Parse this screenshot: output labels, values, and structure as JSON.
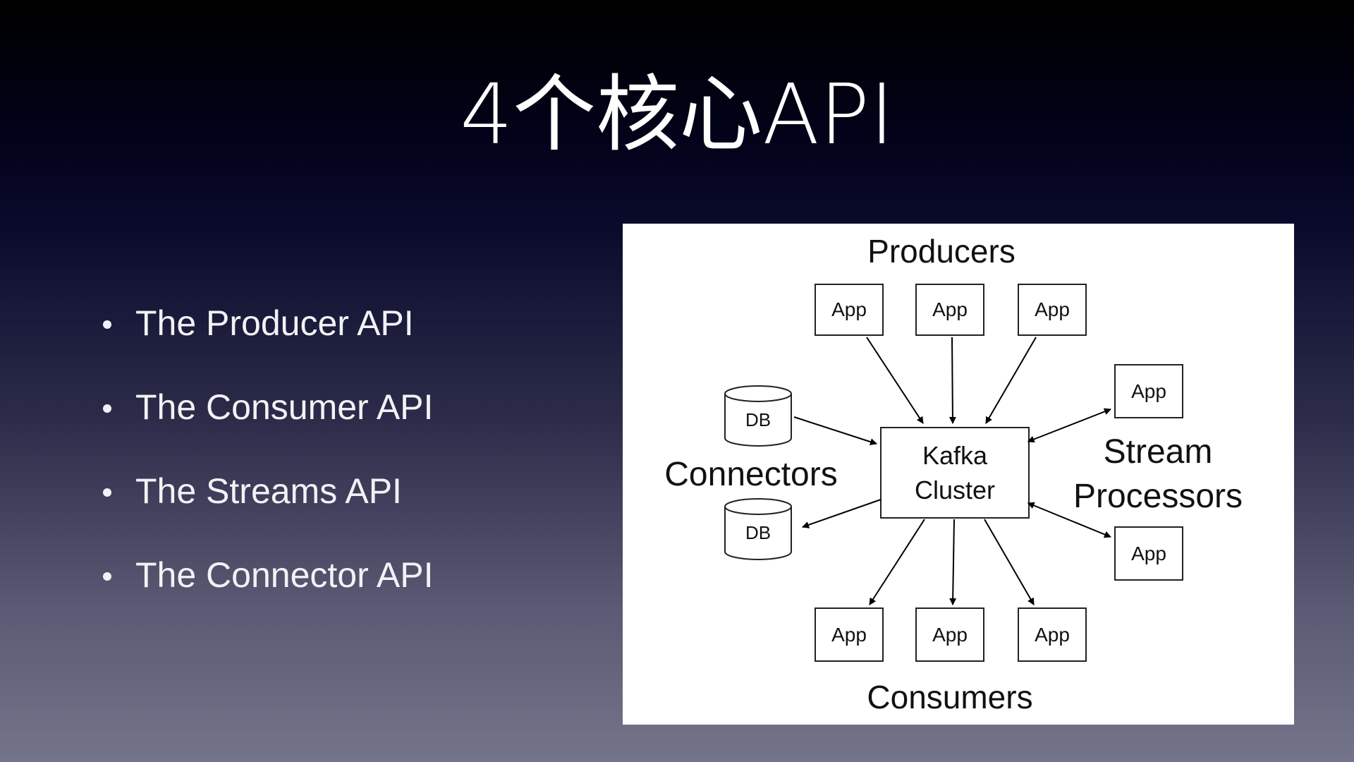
{
  "slide": {
    "title": "4个核心API"
  },
  "bullets": [
    "The Producer API",
    "The Consumer API",
    "The Streams API",
    "The Connector API"
  ],
  "diagram": {
    "producers_label": "Producers",
    "consumers_label": "Consumers",
    "connectors_label": "Connectors",
    "stream_label_line1": "Stream",
    "stream_label_line2": "Processors",
    "cluster_line1": "Kafka",
    "cluster_line2": "Cluster",
    "app_label": "App",
    "db_label": "DB"
  }
}
